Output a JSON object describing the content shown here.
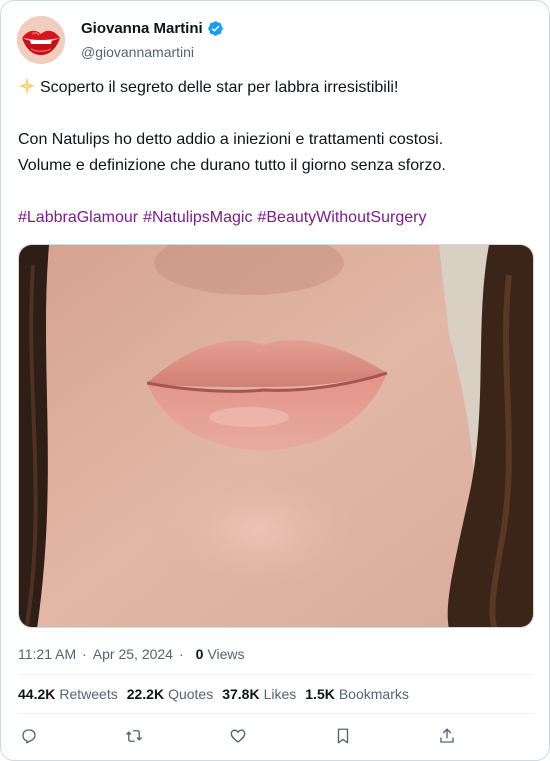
{
  "author": {
    "name": "Giovanna Martini",
    "handle": "@giovannamartini",
    "verified": true
  },
  "tweet": {
    "line1": "Scoperto il segreto delle star per labbra irresistibili!",
    "line2": "Con Natulips ho detto addio a iniezioni e trattamenti costosi.",
    "line3": "Volume e definizione che durano tutto il giorno senza sforzo.",
    "hashtags": [
      "#LabbraGlamour",
      "#NatulipsMagic",
      "#BeautyWithoutSurgery"
    ]
  },
  "meta": {
    "time": "11:21 AM",
    "date": "Apr 25, 2024",
    "views_count": "0",
    "views_label": "Views"
  },
  "stats": {
    "retweets_count": "44.2K",
    "retweets_label": "Retweets",
    "quotes_count": "22.2K",
    "quotes_label": "Quotes",
    "likes_count": "37.8K",
    "likes_label": "Likes",
    "bookmarks_count": "1.5K",
    "bookmarks_label": "Bookmarks"
  },
  "icons": {
    "verified": "verified-badge-icon",
    "sparkle": "sparkle-emoji-icon",
    "reply": "reply-icon",
    "retweet": "retweet-icon",
    "like": "heart-icon",
    "bookmark": "bookmark-icon",
    "share": "share-icon"
  },
  "colors": {
    "hashtag": "#7b1d8a",
    "verified": "#1d9bf0",
    "muted": "#536471"
  }
}
